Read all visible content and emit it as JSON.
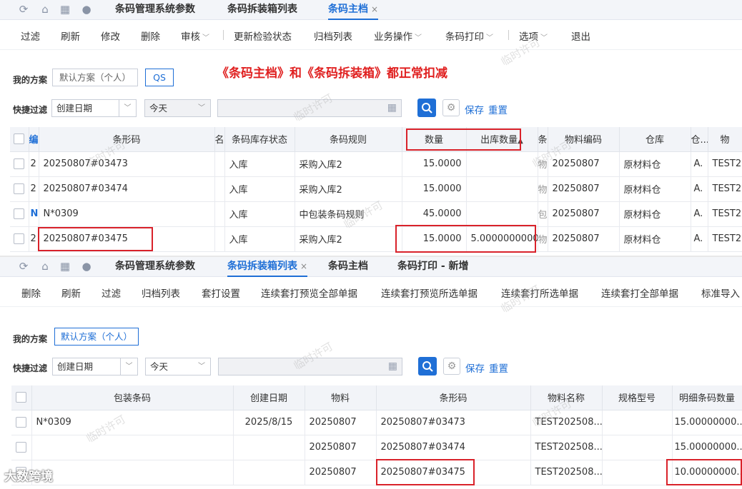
{
  "top": {
    "tabs": [
      {
        "label": "条码管理系统参数"
      },
      {
        "label": "条码拆装箱列表"
      },
      {
        "label": "条码主档",
        "close": "×"
      }
    ],
    "toolbar": {
      "items": [
        "过滤",
        "刷新",
        "修改",
        "删除",
        "审核",
        "更新检验状态",
        "归档列表",
        "业务操作",
        "条码打印",
        "选项",
        "退出"
      ]
    },
    "scheme_label": "我的方案",
    "scheme_default": "默认方案（个人）",
    "scheme_qs": "QS",
    "notice": "《条码主档》和《条码拆装箱》都正常扣减",
    "filter_label": "快捷过滤",
    "filter_field": "创建日期",
    "filter_op": "今天",
    "save": "保存",
    "reset": "重置",
    "columns": [
      "编",
      "条形码",
      "名",
      "条码库存状态",
      "条码规则",
      "数量",
      "出库数量",
      "条",
      "物料编码",
      "仓库",
      "仓...",
      "物"
    ],
    "rows": [
      {
        "c0": "2",
        "barcode": "20250807#03473",
        "status": "入库",
        "rule": "采购入库2",
        "qty": "15.0000",
        "out_qty": "",
        "c7": "物",
        "material": "20250807",
        "warehouse": "原材料仓",
        "w2": "A.",
        "name": "TEST20"
      },
      {
        "c0": "2",
        "barcode": "20250807#03474",
        "status": "入库",
        "rule": "采购入库2",
        "qty": "15.0000",
        "out_qty": "",
        "c7": "物",
        "material": "20250807",
        "warehouse": "原材料仓",
        "w2": "A.",
        "name": "TEST20"
      },
      {
        "c0": "N",
        "barcode": "N*0309",
        "status": "入库",
        "rule": "中包装条码规则",
        "qty": "45.0000",
        "out_qty": "",
        "c7": "包",
        "material": "20250807",
        "warehouse": "原材料仓",
        "w2": "A.",
        "name": "TEST20"
      },
      {
        "c0": "2",
        "barcode": "20250807#03475",
        "status": "入库",
        "rule": "采购入库2",
        "qty": "15.0000",
        "out_qty": "5.0000000000",
        "c7": "物",
        "material": "20250807",
        "warehouse": "原材料仓",
        "w2": "A.",
        "name": "TEST20"
      }
    ]
  },
  "bottom": {
    "tabs": [
      {
        "label": "条码管理系统参数"
      },
      {
        "label": "条码拆装箱列表",
        "close": "×"
      },
      {
        "label": "条码主档"
      },
      {
        "label": "条码打印 - 新增"
      }
    ],
    "toolbar": {
      "items": [
        "删除",
        "刷新",
        "过滤",
        "归档列表",
        "套打设置",
        "连续套打预览全部单据",
        "连续套打预览所选单据",
        "连续套打所选单据",
        "连续套打全部单据",
        "标准导入"
      ]
    },
    "scheme_label": "我的方案",
    "scheme_default": "默认方案（个人）",
    "filter_label": "快捷过滤",
    "filter_field": "创建日期",
    "filter_op": "今天",
    "save": "保存",
    "reset": "重置",
    "columns": [
      "包装条码",
      "创建日期",
      "物料",
      "条形码",
      "物料名称",
      "规格型号",
      "明细条码数量"
    ],
    "rows": [
      {
        "pack": "N*0309",
        "date": "2025/8/15",
        "material": "20250807",
        "barcode": "20250807#03473",
        "name": "TEST202508...",
        "spec": "",
        "qty": "15.00000000..."
      },
      {
        "pack": "",
        "date": "",
        "material": "20250807",
        "barcode": "20250807#03474",
        "name": "TEST202508...",
        "spec": "",
        "qty": "15.00000000..."
      },
      {
        "pack": "",
        "date": "",
        "material": "20250807",
        "barcode": "20250807#03475",
        "name": "TEST202508...",
        "spec": "",
        "qty": "10.00000000..."
      }
    ]
  },
  "watermark": "临时许可",
  "corner_watermark": "大数跨境",
  "colors": {
    "accent": "#1f6fd6",
    "highlight": "#d9222a"
  }
}
